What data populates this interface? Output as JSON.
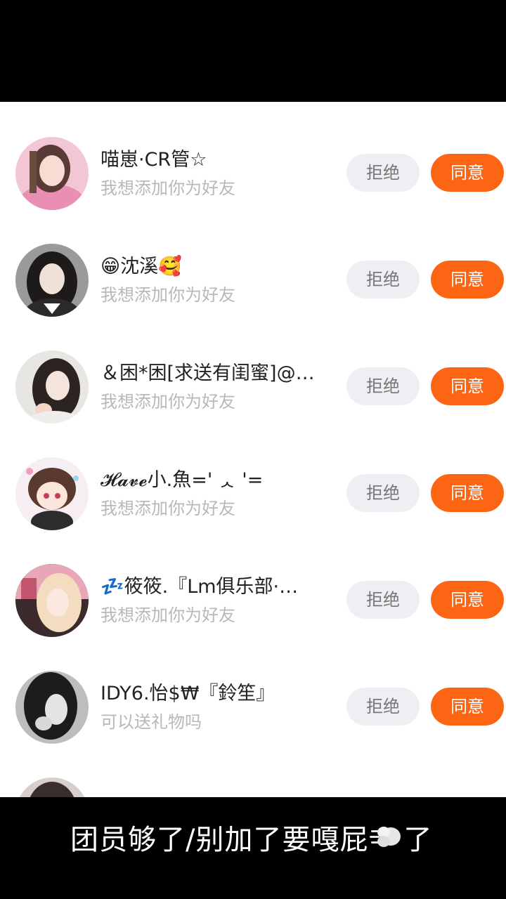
{
  "requests": [
    {
      "name": "喵崽·CR管☆",
      "message": "我想添加你为好友",
      "avatar": "avatar-pink",
      "reject_label": "拒绝",
      "agree_label": "同意"
    },
    {
      "name": "😁沈溪🥰",
      "message": "我想添加你为好友",
      "avatar": "avatar-dark",
      "reject_label": "拒绝",
      "agree_label": "同意"
    },
    {
      "name": "＆困*困[求送有闺蜜]@…",
      "message": "我想添加你为好友",
      "avatar": "avatar-light",
      "reject_label": "拒绝",
      "agree_label": "同意"
    },
    {
      "name": "𝓗𝓪𝓿𝓮小.魚=' ᆺ '=",
      "message": "我想添加你为好友",
      "avatar": "avatar-anime",
      "reject_label": "拒绝",
      "agree_label": "同意"
    },
    {
      "name": "💤筱筱.『Lm俱乐部·…",
      "message": "我想添加你为好友",
      "avatar": "avatar-blonde",
      "reject_label": "拒绝",
      "agree_label": "同意"
    },
    {
      "name": "IDY6.怡$₩『鈴笙』",
      "message": "可以送礼物吗",
      "avatar": "avatar-bw",
      "reject_label": "拒绝",
      "agree_label": "同意"
    }
  ],
  "caption": {
    "text_before": "团员够了/别加了要嘎屁",
    "icon": "dash-puff-icon",
    "text_after": "了"
  },
  "colors": {
    "agree": "#fc6513",
    "reject_bg": "#eeeef3",
    "subtext": "#b8b8b8"
  }
}
